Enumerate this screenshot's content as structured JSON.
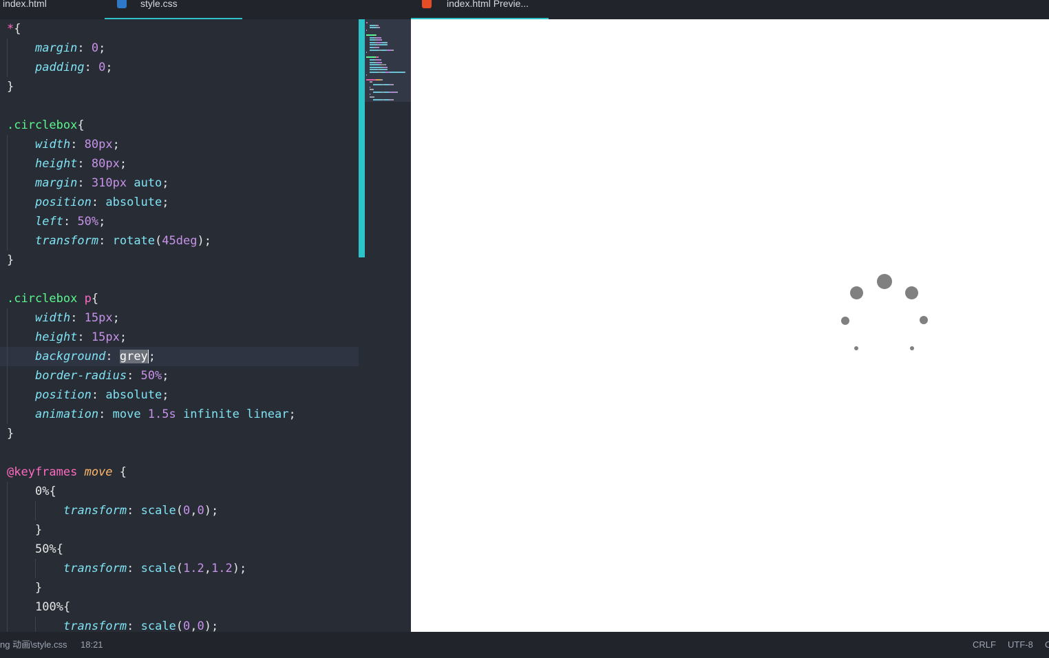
{
  "tabs": [
    {
      "label": "index.html",
      "icon": "none",
      "active": false
    },
    {
      "label": "style.css",
      "icon": "css3-icon",
      "active": true
    },
    {
      "label": "index.html Previe...",
      "icon": "html5-icon",
      "active": true
    }
  ],
  "code_lines": [
    [
      {
        "t": "*",
        "c": "tag"
      },
      {
        "t": "{",
        "c": "punc"
      }
    ],
    [
      {
        "t": "margin",
        "c": "prop"
      },
      {
        "t": ": ",
        "c": "punc"
      },
      {
        "t": "0",
        "c": "num"
      },
      {
        "t": ";",
        "c": "punc"
      }
    ],
    [
      {
        "t": "padding",
        "c": "prop"
      },
      {
        "t": ": ",
        "c": "punc"
      },
      {
        "t": "0",
        "c": "num"
      },
      {
        "t": ";",
        "c": "punc"
      }
    ],
    [
      {
        "t": "}",
        "c": "punc"
      }
    ],
    [],
    [
      {
        "t": ".circlebox",
        "c": "sel"
      },
      {
        "t": "{",
        "c": "punc"
      }
    ],
    [
      {
        "t": "width",
        "c": "prop"
      },
      {
        "t": ": ",
        "c": "punc"
      },
      {
        "t": "80px",
        "c": "num"
      },
      {
        "t": ";",
        "c": "punc"
      }
    ],
    [
      {
        "t": "height",
        "c": "prop"
      },
      {
        "t": ": ",
        "c": "punc"
      },
      {
        "t": "80px",
        "c": "num"
      },
      {
        "t": ";",
        "c": "punc"
      }
    ],
    [
      {
        "t": "margin",
        "c": "prop"
      },
      {
        "t": ": ",
        "c": "punc"
      },
      {
        "t": "310px",
        "c": "num"
      },
      {
        "t": " auto",
        "c": "val"
      },
      {
        "t": ";",
        "c": "punc"
      }
    ],
    [
      {
        "t": "position",
        "c": "prop"
      },
      {
        "t": ": ",
        "c": "punc"
      },
      {
        "t": "absolute",
        "c": "val"
      },
      {
        "t": ";",
        "c": "punc"
      }
    ],
    [
      {
        "t": "left",
        "c": "prop"
      },
      {
        "t": ": ",
        "c": "punc"
      },
      {
        "t": "50%",
        "c": "num"
      },
      {
        "t": ";",
        "c": "punc"
      }
    ],
    [
      {
        "t": "transform",
        "c": "prop"
      },
      {
        "t": ": ",
        "c": "punc"
      },
      {
        "t": "rotate",
        "c": "val"
      },
      {
        "t": "(",
        "c": "punc"
      },
      {
        "t": "45deg",
        "c": "num"
      },
      {
        "t": ");",
        "c": "punc"
      }
    ],
    [
      {
        "t": "}",
        "c": "punc"
      }
    ],
    [],
    [
      {
        "t": ".circlebox",
        "c": "sel"
      },
      {
        "t": " p",
        "c": "tag"
      },
      {
        "t": "{",
        "c": "punc"
      }
    ],
    [
      {
        "t": "width",
        "c": "prop"
      },
      {
        "t": ": ",
        "c": "punc"
      },
      {
        "t": "15px",
        "c": "num"
      },
      {
        "t": ";",
        "c": "punc"
      }
    ],
    [
      {
        "t": "height",
        "c": "prop"
      },
      {
        "t": ": ",
        "c": "punc"
      },
      {
        "t": "15px",
        "c": "num"
      },
      {
        "t": ";",
        "c": "punc"
      }
    ],
    [
      {
        "t": "background",
        "c": "prop"
      },
      {
        "t": ": ",
        "c": "punc"
      },
      {
        "t": "grey",
        "c": "selected"
      },
      {
        "t": "",
        "c": "caret"
      },
      {
        "t": ";",
        "c": "punc"
      }
    ],
    [
      {
        "t": "border-radius",
        "c": "prop"
      },
      {
        "t": ": ",
        "c": "punc"
      },
      {
        "t": "50%",
        "c": "num"
      },
      {
        "t": ";",
        "c": "punc"
      }
    ],
    [
      {
        "t": "position",
        "c": "prop"
      },
      {
        "t": ": ",
        "c": "punc"
      },
      {
        "t": "absolute",
        "c": "val"
      },
      {
        "t": ";",
        "c": "punc"
      }
    ],
    [
      {
        "t": "animation",
        "c": "prop"
      },
      {
        "t": ": ",
        "c": "punc"
      },
      {
        "t": "move ",
        "c": "val"
      },
      {
        "t": "1.5s",
        "c": "num"
      },
      {
        "t": " infinite linear",
        "c": "val"
      },
      {
        "t": ";",
        "c": "punc"
      }
    ],
    [
      {
        "t": "}",
        "c": "punc"
      }
    ],
    [],
    [
      {
        "t": "@keyframes",
        "c": "at"
      },
      {
        "t": " move",
        "c": "name"
      },
      {
        "t": " {",
        "c": "punc"
      }
    ],
    [
      {
        "t": "0%{",
        "c": "punc"
      }
    ],
    [
      {
        "t": "transform",
        "c": "prop"
      },
      {
        "t": ": ",
        "c": "punc"
      },
      {
        "t": "scale",
        "c": "val"
      },
      {
        "t": "(",
        "c": "punc"
      },
      {
        "t": "0",
        "c": "num"
      },
      {
        "t": ",",
        "c": "punc"
      },
      {
        "t": "0",
        "c": "num"
      },
      {
        "t": ");",
        "c": "punc"
      }
    ],
    [
      {
        "t": "}",
        "c": "punc"
      }
    ],
    [
      {
        "t": "50%{",
        "c": "punc"
      }
    ],
    [
      {
        "t": "transform",
        "c": "prop"
      },
      {
        "t": ": ",
        "c": "punc"
      },
      {
        "t": "scale",
        "c": "val"
      },
      {
        "t": "(",
        "c": "punc"
      },
      {
        "t": "1.2",
        "c": "num"
      },
      {
        "t": ",",
        "c": "punc"
      },
      {
        "t": "1.2",
        "c": "num"
      },
      {
        "t": ");",
        "c": "punc"
      }
    ],
    [
      {
        "t": "}",
        "c": "punc"
      }
    ],
    [
      {
        "t": "100%{",
        "c": "punc"
      }
    ],
    [
      {
        "t": "transform",
        "c": "prop"
      },
      {
        "t": ": ",
        "c": "punc"
      },
      {
        "t": "scale",
        "c": "val"
      },
      {
        "t": "(",
        "c": "punc"
      },
      {
        "t": "0",
        "c": "num"
      },
      {
        "t": ",",
        "c": "punc"
      },
      {
        "t": "0",
        "c": "num"
      },
      {
        "t": ");",
        "c": "punc"
      }
    ]
  ],
  "status": {
    "file_path": "ng 动画\\style.css",
    "cursor_position": "18:21",
    "line_ending": "CRLF",
    "encoding": "UTF-8",
    "overflow_char": "C"
  },
  "colors": {
    "accent": "#2cc4c9",
    "editor_bg": "#282c34",
    "preview_bg": "#ffffff",
    "dot_color": "#808080"
  }
}
